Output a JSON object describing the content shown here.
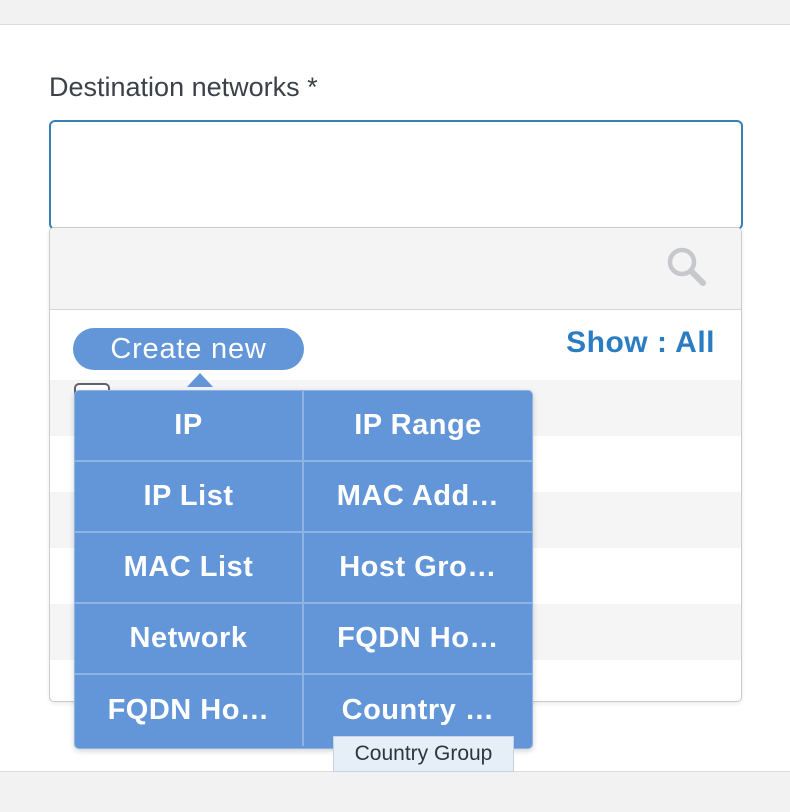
{
  "field": {
    "label": "Destination networks *"
  },
  "dropdown": {
    "show_filter": "Show : All"
  },
  "create_new": {
    "label": "Create new",
    "items": [
      {
        "label": "IP"
      },
      {
        "label": "IP Range"
      },
      {
        "label": "IP List"
      },
      {
        "label": "MAC Add…"
      },
      {
        "label": "MAC List"
      },
      {
        "label": "Host Gro…"
      },
      {
        "label": "Network"
      },
      {
        "label": "FQDN Ho…"
      },
      {
        "label": "FQDN Ho…"
      },
      {
        "label": "Country …"
      }
    ]
  },
  "tooltip": {
    "text": "Country Group"
  },
  "colors": {
    "accent": "#6296d8",
    "link": "#2b7dc3",
    "focus_border": "#3a7fb5"
  },
  "icons": {
    "search": "search-icon"
  }
}
